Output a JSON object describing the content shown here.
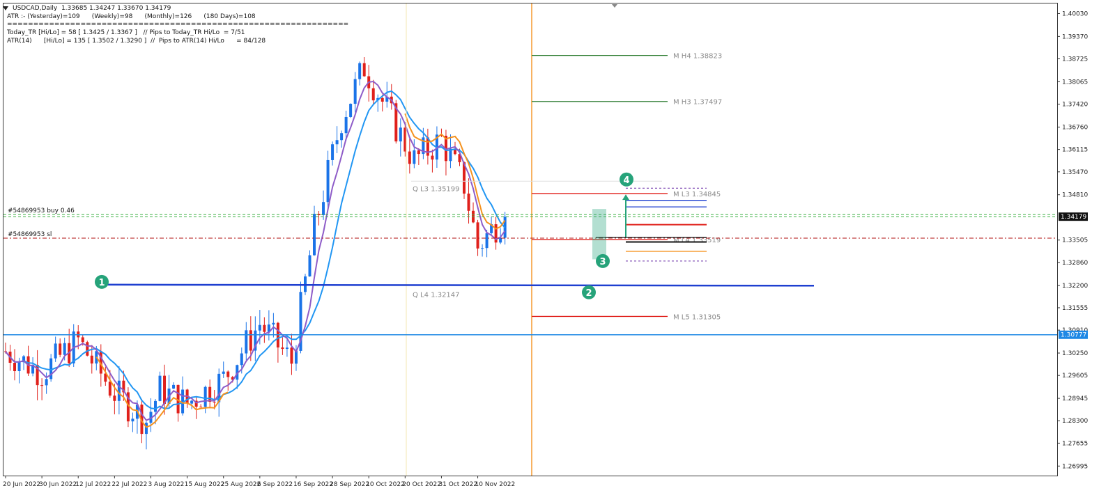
{
  "header": {
    "symbol_line": "USDCAD,Daily  1.33685 1.34247 1.33670 1.34179",
    "atr_line": "ATR :- (Yesterday)=109      (Weekly)=98      (Monthly)=126      (180 Days)=108",
    "separator": "=================================================================",
    "today_tr_line": "Today_TR [Hi/Lo] = 58 [ 1.3425 / 1.3367 ]   // Pips to Today_TR Hi/Lo  = 7/51",
    "atr14_line": "ATR(14)      [Hi/Lo] = 135 [ 1.3502 / 1.3290 ]  //  Pips to ATR(14) Hi/Lo      = 84/128"
  },
  "chart_data": {
    "type": "candlestick",
    "symbol": "USDCAD",
    "timeframe": "Daily",
    "ohlc_current": {
      "open": 1.33685,
      "high": 1.34247,
      "low": 1.3367,
      "close": 1.34179
    },
    "y_ticks": [
      "1.40030",
      "1.39370",
      "1.38725",
      "1.38065",
      "1.37420",
      "1.36760",
      "1.36115",
      "1.35470",
      "1.34810",
      "1.34179",
      "1.33505",
      "1.32860",
      "1.32200",
      "1.31555",
      "1.30910",
      "1.30777",
      "1.30250",
      "1.29605",
      "1.28945",
      "1.28300",
      "1.27655",
      "1.26995"
    ],
    "x_ticks": [
      "20 Jun 2022",
      "30 Jun 2022",
      "12 Jul 2022",
      "22 Jul 2022",
      "3 Aug 2022",
      "15 Aug 2022",
      "25 Aug 2022",
      "6 Sep 2022",
      "16 Sep 2022",
      "28 Sep 2022",
      "10 Oct 2022",
      "20 Oct 2022",
      "31 Oct 2022",
      "10 Nov 2022"
    ],
    "ylim": [
      1.2672,
      1.4032
    ],
    "current_price_label": "1.34179",
    "hline_price_label": "1.30777",
    "levels": [
      {
        "label": "M  H4 1.38823",
        "price": 1.38823,
        "color": "#2e7d32"
      },
      {
        "label": "M  H3 1.37497",
        "price": 1.37497,
        "color": "#2e7d32"
      },
      {
        "label": "M  L3 1.34845",
        "price": 1.34845,
        "color": "#e0201b"
      },
      {
        "label": "M  L4 1.33519",
        "price": 1.33519,
        "color": "#e0201b"
      },
      {
        "label": "M  L5 1.31305",
        "price": 1.31305,
        "color": "#e0201b"
      },
      {
        "label": "Q  L3 1.35199",
        "price": 1.35199,
        "color": "#bdbdbd"
      },
      {
        "label": "Q  L4 1.32147",
        "price": 1.32147,
        "color": "#1e3fd0"
      }
    ],
    "orders": [
      {
        "label": "#54869953 buy 0.46",
        "price": 1.3424
      },
      {
        "label": "#54869953 sl",
        "price": 1.3356
      }
    ],
    "markers": [
      "1",
      "2",
      "3",
      "4"
    ],
    "colors": {
      "bull": "#1a73e8",
      "bear": "#e0201b",
      "ma_fast": "#8e5cc8",
      "ma_slow": "#2196f3",
      "ma_orange": "#f5921e",
      "support": "#1e3fd0",
      "hline": "#1e88e5",
      "vline": "#f5921e",
      "marker": "#26a37a"
    }
  }
}
